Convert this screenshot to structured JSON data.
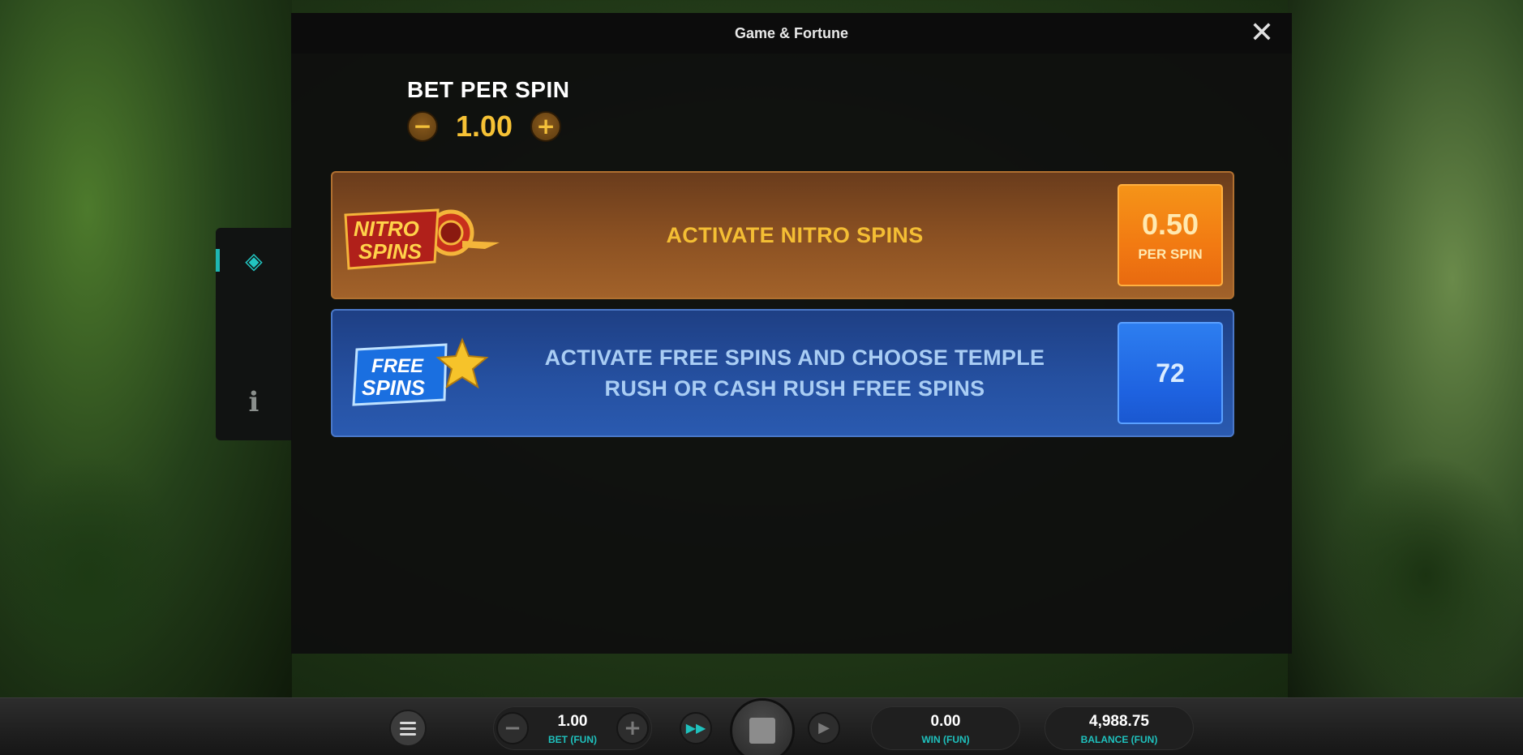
{
  "modal": {
    "title": "Game & Fortune",
    "close_symbol": "✕"
  },
  "bet": {
    "label": "BET PER SPIN",
    "value": "1.00",
    "minus_symbol": "−",
    "plus_symbol": "+"
  },
  "features": [
    {
      "logo_line1": "NITRO",
      "logo_line2": "SPINS",
      "text": "ACTIVATE NITRO SPINS",
      "price": "0.50",
      "price_unit": "PER SPIN"
    },
    {
      "logo_line1": "FREE",
      "logo_line2": "SPINS",
      "text": "ACTIVATE FREE SPINS AND CHOOSE TEMPLE RUSH OR CASH RUSH FREE SPINS",
      "price": "72"
    }
  ],
  "side_panel": {
    "tabs": [
      {
        "icon": "feature-buy-icon",
        "glyph": "◈",
        "active": true
      },
      {
        "icon": "info-icon",
        "glyph": "i",
        "active": false
      }
    ]
  },
  "bottom_bar": {
    "bet_value": "1.00",
    "bet_label": "BET (FUN)",
    "win_value": "0.00",
    "win_label": "WIN (FUN)",
    "balance_value": "4,988.75",
    "balance_label": "BALANCE (FUN)",
    "minus_symbol": "−",
    "plus_symbol": "+",
    "fast_symbol": "▶▶",
    "play_symbol": "▶"
  },
  "colors": {
    "accent_teal": "#1fc1bd",
    "nitro_text": "#f4be34",
    "free_text": "#a9cdf4",
    "nitro_price_bg": "#f27a12",
    "free_price_bg": "#1e62e0"
  }
}
